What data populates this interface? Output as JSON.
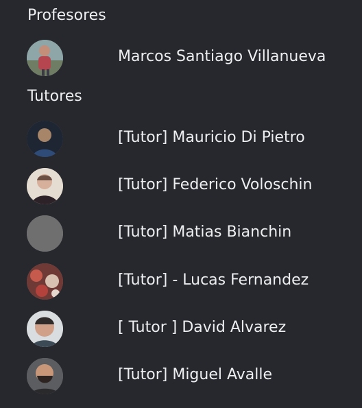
{
  "members_panel": {
    "profesores": {
      "title": "Profesores",
      "members": [
        {
          "name": "Marcos Santiago Villanueva",
          "avatar": "avatar-photo-outdoor"
        }
      ]
    },
    "tutores": {
      "title": "Tutores",
      "members": [
        {
          "name": "[Tutor] Mauricio Di Pietro",
          "avatar": "avatar-photo-dark"
        },
        {
          "name": "[Tutor] Federico Voloschin",
          "avatar": "avatar-photo-light"
        },
        {
          "name": "[Tutor] Matias Bianchin",
          "avatar": "avatar-placeholder-gray"
        },
        {
          "name": "[Tutor] - Lucas Fernandez",
          "avatar": "avatar-photo-red"
        },
        {
          "name": "[ Tutor ] David Alvarez",
          "avatar": "avatar-photo-face"
        },
        {
          "name": "[Tutor] Miguel Avalle",
          "avatar": "avatar-photo-beard"
        }
      ]
    }
  },
  "colors": {
    "background": "#27282d",
    "text": "#eceef0",
    "placeholder_avatar": "#6f6f6f"
  }
}
